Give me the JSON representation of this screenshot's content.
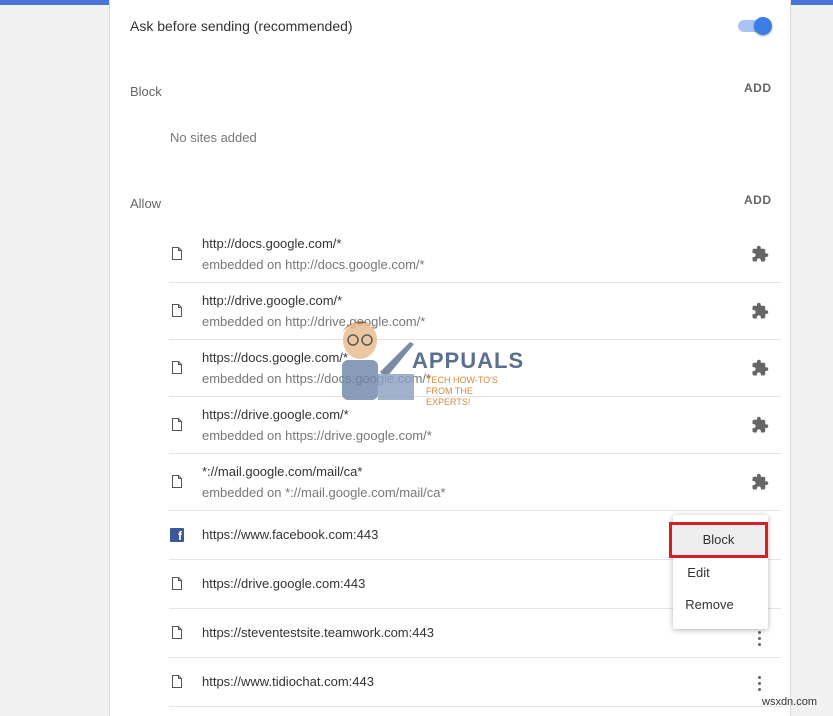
{
  "header": {
    "ask_label": "Ask before sending (recommended)",
    "toggle_on": true,
    "accent": "#3c7de3"
  },
  "block": {
    "title": "Block",
    "add_label": "ADD",
    "empty_text": "No sites added"
  },
  "allow": {
    "title": "Allow",
    "add_label": "ADD",
    "items": [
      {
        "primary": "http://docs.google.com/*",
        "secondary": "embedded on http://docs.google.com/*",
        "action_icon": "puzzle-icon"
      },
      {
        "primary": "http://drive.google.com/*",
        "secondary": "embedded on http://drive.google.com/*",
        "action_icon": "puzzle-icon"
      },
      {
        "primary": "https://docs.google.com/*",
        "secondary": "embedded on https://docs.google.com/*",
        "action_icon": "puzzle-icon"
      },
      {
        "primary": "https://drive.google.com/*",
        "secondary": "embedded on https://drive.google.com/*",
        "action_icon": "puzzle-icon"
      },
      {
        "primary": "*://mail.google.com/mail/ca*",
        "secondary": "embedded on *://mail.google.com/mail/ca*",
        "action_icon": "puzzle-icon"
      },
      {
        "primary": "https://www.facebook.com:443",
        "site_icon": "facebook-icon",
        "action_icon": "more-icon"
      },
      {
        "primary": "https://drive.google.com:443",
        "action_icon": "more-icon"
      },
      {
        "primary": "https://steventestsite.teamwork.com:443",
        "action_icon": "more-icon"
      },
      {
        "primary": "https://www.tidiochat.com:443",
        "action_icon": "more-icon"
      }
    ]
  },
  "context_menu": {
    "items": [
      "Block",
      "Edit",
      "Remove"
    ],
    "highlighted": "Block",
    "highlight_color": "#d61f26"
  },
  "watermark": {
    "brand": "APPUALS",
    "tagline": "TECH HOW-TO'S FROM THE EXPERTS!"
  },
  "footer": {
    "site": "wsxdn.com"
  }
}
